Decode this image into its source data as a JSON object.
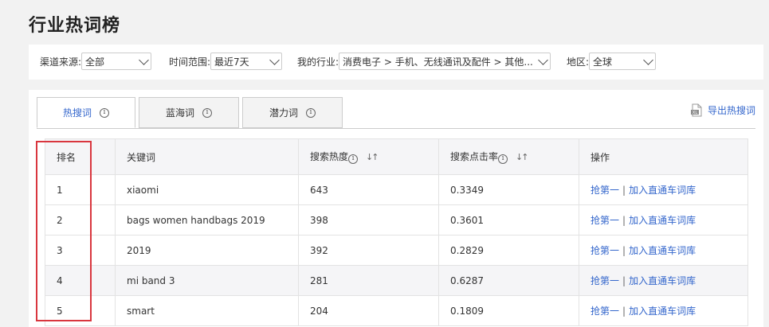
{
  "page": {
    "title": "行业热词榜"
  },
  "filters": [
    {
      "label": "渠道来源:",
      "value": "全部"
    },
    {
      "label": "时间范围:",
      "value": "最近7天"
    },
    {
      "label": "我的行业:",
      "value": "消费电子 > 手机、无线通讯及配件 > 其他..."
    },
    {
      "label": "地区:",
      "value": "全球"
    }
  ],
  "tabs": [
    {
      "label": "热搜词",
      "active": true
    },
    {
      "label": "蓝海词",
      "active": false
    },
    {
      "label": "潜力词",
      "active": false
    }
  ],
  "export_label": "导出热搜词",
  "table": {
    "headers": {
      "rank": "排名",
      "keyword": "关键词",
      "heat": "搜索热度",
      "ctr": "搜索点击率",
      "action": "操作"
    },
    "rows": [
      {
        "rank": "1",
        "keyword": "xiaomi",
        "heat": "643",
        "ctr": "0.3349",
        "action1": "抢第一",
        "sep": "|",
        "action2": "加入直通车词库"
      },
      {
        "rank": "2",
        "keyword": "bags women handbags 2019",
        "heat": "398",
        "ctr": "0.3601",
        "action1": "抢第一",
        "sep": "|",
        "action2": "加入直通车词库"
      },
      {
        "rank": "3",
        "keyword": "2019",
        "heat": "392",
        "ctr": "0.2829",
        "action1": "抢第一",
        "sep": "|",
        "action2": "加入直通车词库"
      },
      {
        "rank": "4",
        "keyword": "mi band 3",
        "heat": "281",
        "ctr": "0.6287",
        "action1": "抢第一",
        "sep": "|",
        "action2": "加入直通车词库"
      },
      {
        "rank": "5",
        "keyword": "smart",
        "heat": "204",
        "ctr": "0.1809",
        "action1": "抢第一",
        "sep": "|",
        "action2": "加入直通车词库"
      }
    ]
  },
  "colors": {
    "link": "#3366cc",
    "highlight": "#d9363e",
    "header_bg": "#f5f5f7"
  },
  "icons": {
    "info": "info-icon",
    "sort": "sort-icon",
    "excel": "excel-icon",
    "dropdown": "chevron-down-icon"
  }
}
